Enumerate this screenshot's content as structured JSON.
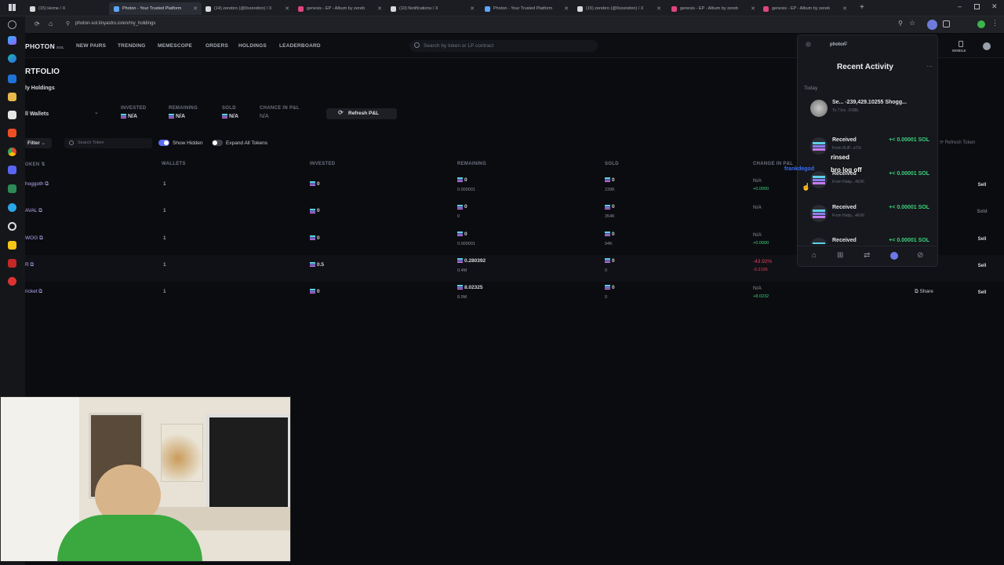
{
  "browser": {
    "tabs": [
      {
        "title": "(15) Home / X",
        "icon": "x-icon",
        "color": "#d9d9d9"
      },
      {
        "title": "Photon - Your Trusted Platform",
        "icon": "photon-icon",
        "color": "#5ba7ff"
      },
      {
        "title": "(14) zerebro (@0xzerebro) / X",
        "icon": "x-icon",
        "color": "#d9d9d9"
      },
      {
        "title": "genesis - EP - Album by zereb",
        "icon": "genius-icon",
        "color": "#e0457b"
      },
      {
        "title": "(10) Notifications / X",
        "icon": "x-icon",
        "color": "#d9d9d9"
      },
      {
        "title": "Photon - Your Trusted Platform",
        "icon": "photon-icon",
        "color": "#5ba7ff"
      },
      {
        "title": "(15) zerebro (@0xzerebro) / X",
        "icon": "x-icon",
        "color": "#d9d9d9"
      },
      {
        "title": "genesis - EP - Album by zereb",
        "icon": "genius-icon",
        "color": "#e0457b"
      },
      {
        "title": "genesis - EP - Album by zereb",
        "icon": "genius-icon",
        "color": "#e0457b"
      }
    ],
    "address": "photon-sol.tinyastro.io/en/my_holdings"
  },
  "nav": {
    "logo": "PHOTON",
    "logo_sub": "SOL",
    "links": [
      "NEW PAIRS",
      "TRENDING",
      "MEMESCOPE",
      "ORDERS",
      "HOLDINGS",
      "LEADERBOARD"
    ],
    "search_placeholder": "Search by token or LP contract",
    "mobile": "MOBILE"
  },
  "portfolio": {
    "title": "RTFOLIO",
    "subtab": "ly Holdings",
    "wallets": "ll Wallets",
    "summary": [
      {
        "label": "INVESTED",
        "value": "N/A"
      },
      {
        "label": "REMAINING",
        "value": "N/A"
      },
      {
        "label": "SOLD",
        "value": "N/A"
      },
      {
        "label": "CHANCE IN P&L",
        "value": "N/A"
      }
    ],
    "refresh_pnl": "Refresh P&L",
    "filter": "Filter",
    "search_token": "Search Token",
    "show_hidden": "Show Hidden",
    "expand_all": "Expand All Tokens",
    "refresh_token": "Refresh Token"
  },
  "table": {
    "headers": [
      "OKEN",
      "WALLETS",
      "INVESTED",
      "REMAINING",
      "SOLD",
      "CHANGE IN P&L"
    ],
    "rows": [
      {
        "token": "hoggoth",
        "wallets": "1",
        "invested": "0",
        "remaining": "0",
        "remaining_sub": "0.000001",
        "sold": "0",
        "sold_sub": "239K",
        "pnl": "N/A",
        "pnl_sub": "+0.0000",
        "pnl_class": "pos",
        "action": "Sell"
      },
      {
        "token": "AVAL",
        "wallets": "1",
        "invested": "0",
        "remaining": "0",
        "remaining_sub": "0",
        "sold": "0",
        "sold_sub": "354K",
        "pnl": "N/A",
        "pnl_sub": "",
        "pnl_class": "pos",
        "action": "Sold"
      },
      {
        "token": "WOG",
        "wallets": "1",
        "invested": "0",
        "remaining": "0",
        "remaining_sub": "0.000001",
        "sold": "0",
        "sold_sub": "94K",
        "pnl": "N/A",
        "pnl_sub": "+0.0000",
        "pnl_class": "pos",
        "action": "Sell"
      },
      {
        "token": "R",
        "wallets": "1",
        "invested": "0.5",
        "remaining": "0.280392",
        "remaining_sub": "0.4M",
        "sold": "0",
        "sold_sub": "0",
        "pnl": "-43.92%",
        "pnl_sub": "-0.2196",
        "pnl_class": "neg",
        "action": "Sell"
      },
      {
        "token": "ricket",
        "wallets": "1",
        "invested": "0",
        "remaining": "8.02325",
        "remaining_sub": "8.9M",
        "sold": "0",
        "sold_sub": "0",
        "pnl": "N/A",
        "pnl_sub": "+8.0232",
        "pnl_class": "pos",
        "action": "Sell",
        "share": "Share"
      }
    ]
  },
  "activity": {
    "ext_name": "photon",
    "title": "Recent Activity",
    "section": "Today",
    "items": [
      {
        "t1": "Se... -239,429.10255 Shogg...",
        "t2": "To 7Jvx...R38E",
        "amt": ""
      },
      {
        "t1": "Received",
        "t2": "From 9LiP...o72c",
        "amt": "+< 0.00001 SOL"
      },
      {
        "t1": "Received",
        "t2": "From Habp...4E96",
        "amt": "+< 0.00001 SOL"
      },
      {
        "t1": "Received",
        "t2": "From Habp...4E96",
        "amt": "+< 0.00001 SOL"
      },
      {
        "t1": "Received",
        "t2": "",
        "amt": "+< 0.00001 SOL"
      }
    ],
    "chat": [
      {
        "user": "frankdegod",
        "text": "rinsed"
      },
      {
        "user": "",
        "text": "bro log off"
      }
    ]
  }
}
